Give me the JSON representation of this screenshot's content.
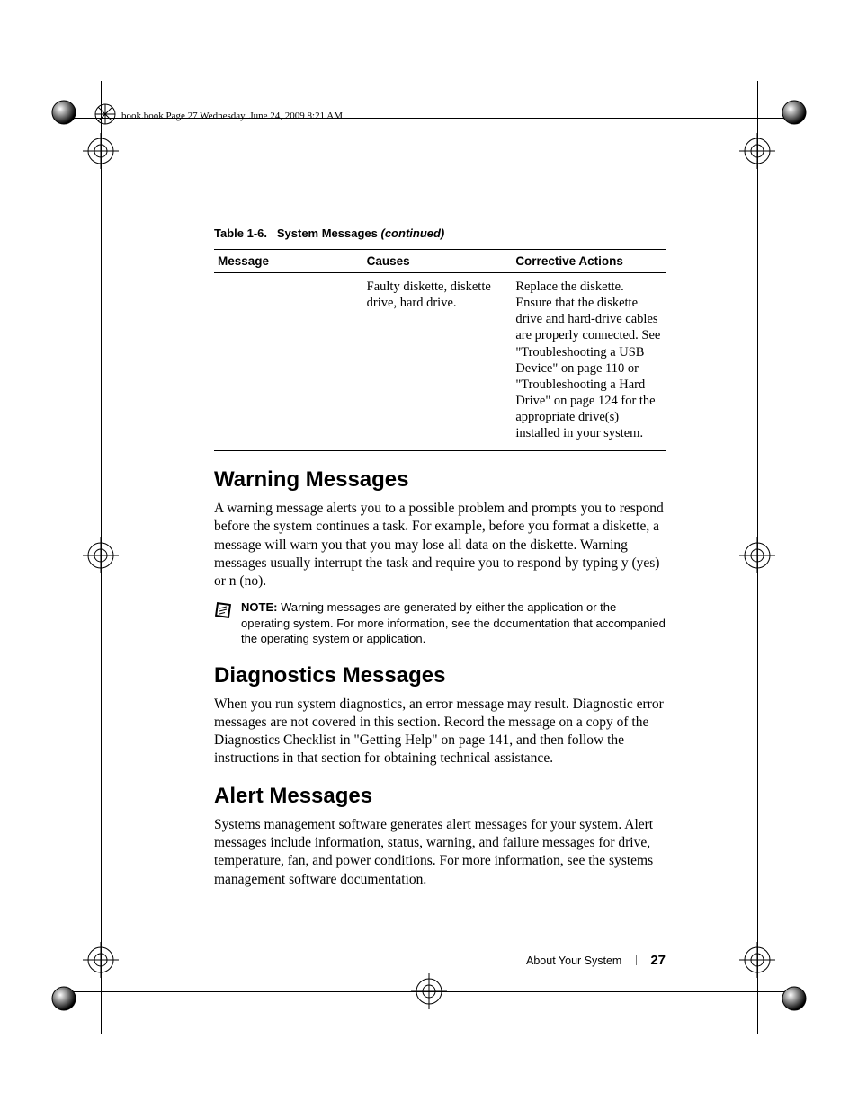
{
  "header": {
    "running_head": "book.book  Page 27  Wednesday, June 24, 2009  8:21 AM"
  },
  "table": {
    "caption_prefix": "Table 1-6.",
    "caption_title": "System Messages",
    "caption_suffix": "(continued)",
    "headers": [
      "Message",
      "Causes",
      "Corrective Actions"
    ],
    "rows": [
      {
        "message": "",
        "causes": "Faulty diskette, diskette drive, hard drive.",
        "actions": "Replace the diskette. Ensure that the diskette drive and hard-drive cables are properly connected. See \"Troubleshooting a USB Device\" on page 110 or \"Troubleshooting a Hard Drive\" on page 124 for the appropriate drive(s) installed in your system."
      }
    ]
  },
  "sections": [
    {
      "heading": "Warning Messages",
      "body": "A warning message alerts you to a possible problem and prompts you to respond before the system continues a task. For example, before you format a diskette, a message will warn you that you may lose all data on the diskette. Warning messages usually interrupt the task and require you to respond by typing y (yes) or n (no).",
      "note": {
        "label": "NOTE:",
        "text": "Warning messages are generated by either the application or the operating system. For more information, see the documentation that accompanied the operating system or application."
      }
    },
    {
      "heading": "Diagnostics Messages",
      "body": "When you run system diagnostics, an error message may result. Diagnostic error messages are not covered in this section. Record the message on a copy of the Diagnostics Checklist in \"Getting Help\" on page 141, and then follow the instructions in that section for obtaining technical assistance."
    },
    {
      "heading": "Alert Messages",
      "body": "Systems management software generates alert messages for your system. Alert messages include information, status, warning, and failure messages for drive, temperature, fan, and power conditions. For more information, see the systems management software documentation."
    }
  ],
  "footer": {
    "section_name": "About Your System",
    "page_number": "27"
  }
}
